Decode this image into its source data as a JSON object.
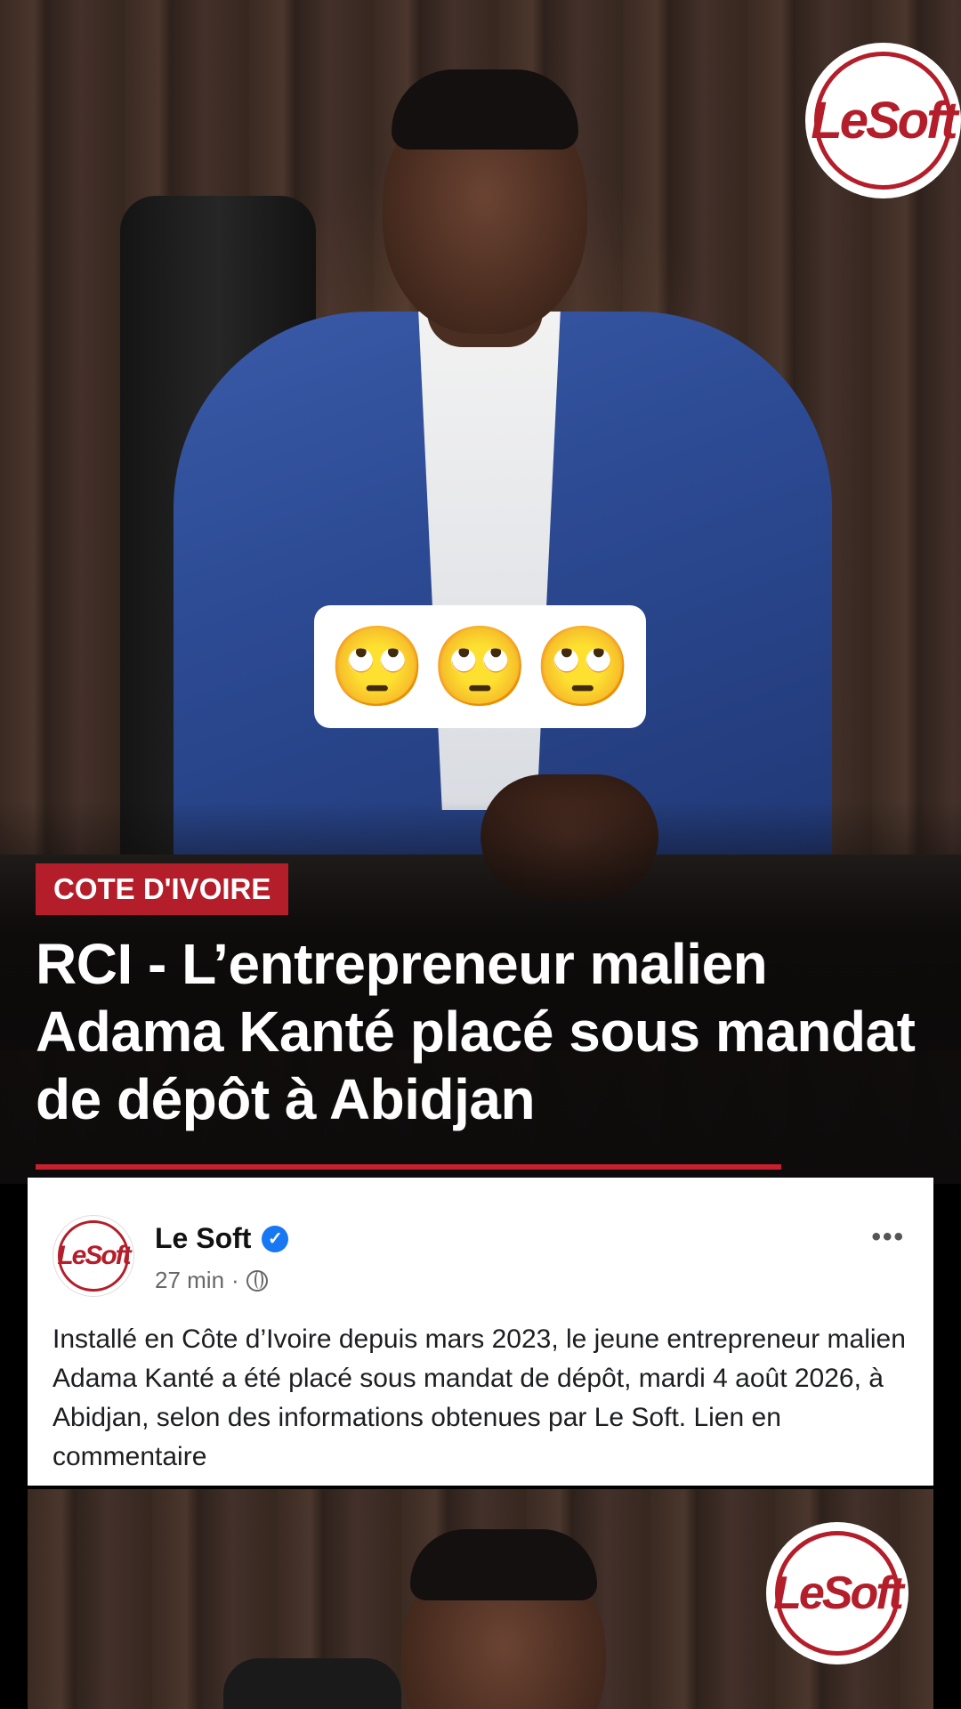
{
  "brand": {
    "logo_text": "LeSoft",
    "accent_color": "#b31e2a"
  },
  "overlay": {
    "emojis": [
      "🙄",
      "🙄",
      "🙄"
    ]
  },
  "article": {
    "category": "COTE D'IVOIRE",
    "headline": "RCI - L’entrepreneur malien Adama Kanté placé sous mandat de dépôt à Abidjan"
  },
  "post": {
    "author": "Le Soft",
    "verified": true,
    "time": "27 min",
    "separator": "·",
    "privacy_icon": "globe-icon",
    "more_icon": "more-options-icon",
    "text": "Installé en Côte d’Ivoire depuis mars 2023, le jeune entrepreneur malien Adama Kanté a été placé sous mandat de dépôt, mardi 4 août 2026, à Abidjan, selon des informations obtenues par Le Soft. Lien en commentaire"
  }
}
